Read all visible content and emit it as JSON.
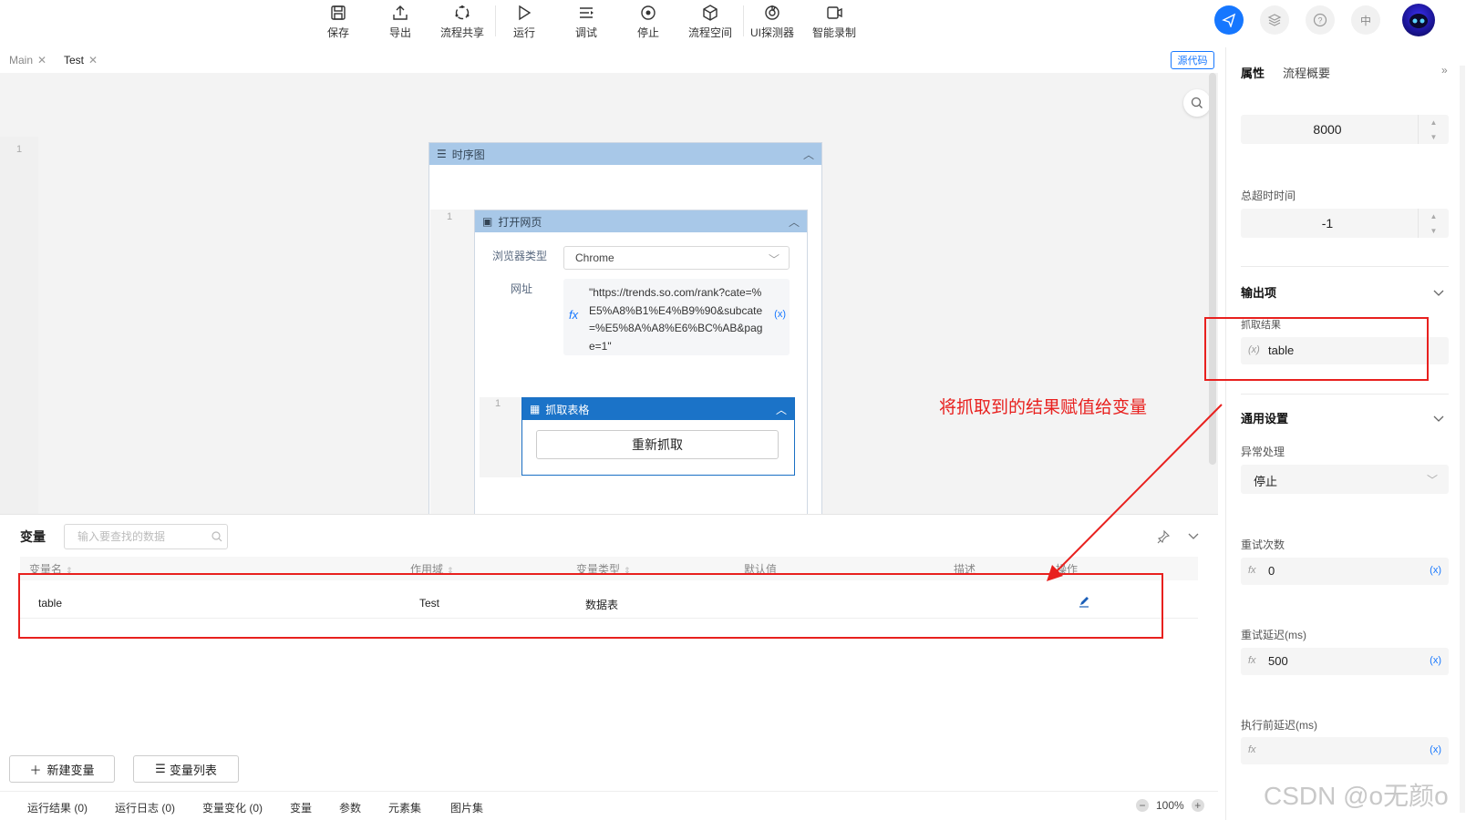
{
  "toolbar": {
    "buttons": [
      {
        "label": "保存",
        "icon": "save-icon"
      },
      {
        "label": "导出",
        "icon": "export-icon"
      },
      {
        "label": "流程共享",
        "icon": "share-icon"
      },
      {
        "label": "运行",
        "icon": "run-icon"
      },
      {
        "label": "调试",
        "icon": "debug-icon"
      },
      {
        "label": "停止",
        "icon": "stop-icon"
      },
      {
        "label": "流程空间",
        "icon": "cube-icon"
      },
      {
        "label": "UI探测器",
        "icon": "detector-icon"
      },
      {
        "label": "智能录制",
        "icon": "record-icon"
      }
    ],
    "lang_label": "中"
  },
  "tabs": [
    {
      "label": "Main"
    },
    {
      "label": "Test",
      "active": true
    }
  ],
  "source_code_label": "源代码",
  "canvas": {
    "line_number": "1",
    "sequence": {
      "title": "时序图",
      "line_number": "1"
    },
    "open_web": {
      "title": "打开网页",
      "browser_type_label": "浏览器类型",
      "browser_type_value": "Chrome",
      "url_label": "网址",
      "url_value": "\"https://trends.so.com/rank?cate=%E5%A8%B1%E4%B9%90&subcate=%E5%8A%A8%E6%BC%AB&page=1\"",
      "fx_label": "fx",
      "var_label": "(x)"
    },
    "grab_table": {
      "title": "抓取表格",
      "line_number": "1",
      "button_label": "重新抓取"
    }
  },
  "variables_panel": {
    "title": "变量",
    "search_placeholder": "输入要查找的数据",
    "columns": [
      "变量名",
      "作用域",
      "变量类型",
      "默认值",
      "描述",
      "操作"
    ],
    "rows": [
      {
        "name": "table",
        "scope": "Test",
        "type": "数据表",
        "default": "",
        "description": ""
      }
    ],
    "new_button": "新建变量",
    "list_button": "变量列表"
  },
  "bottom_tabs": [
    "运行结果 (0)",
    "运行日志 (0)",
    "变量变化 (0)",
    "变量",
    "参数",
    "元素集",
    "图片集"
  ],
  "zoom": "100%",
  "right_panel": {
    "tabs": [
      "属性",
      "流程概要"
    ],
    "timeout_value": "8000",
    "total_timeout_label": "总超时时间",
    "total_timeout_value": "-1",
    "output_section": "输出项",
    "output_label": "抓取结果",
    "output_prefix": "(x)",
    "output_value": "table",
    "general_section": "通用设置",
    "exception_label": "异常处理",
    "exception_value": "停止",
    "retry_count_label": "重试次数",
    "retry_count_value": "0",
    "retry_delay_label": "重试延迟(ms)",
    "retry_delay_value": "500",
    "pre_delay_label": "执行前延迟(ms)",
    "pre_delay_value": "",
    "fx_label": "fx",
    "var_label": "(x)"
  },
  "annotation": "将抓取到的结果赋值给变量",
  "watermark": "CSDN @o无颜o",
  "colors": {
    "accent": "#1677ff",
    "annotation_red": "#e8201e",
    "block_head": "#a8c8e8",
    "block_head_active": "#1b73c8"
  }
}
